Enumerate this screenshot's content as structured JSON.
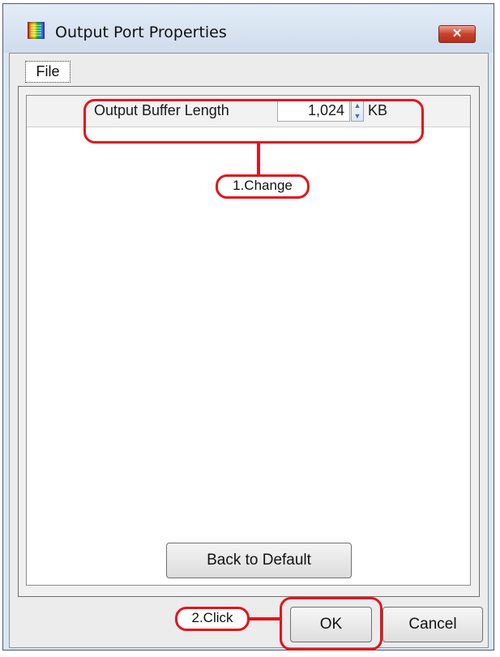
{
  "window": {
    "title": "Output Port Properties",
    "close_symbol": "✕",
    "icon": "app-icon"
  },
  "menu": {
    "items": [
      "File"
    ]
  },
  "buffer": {
    "label": "Output Buffer Length",
    "value": "1,024",
    "unit": "KB"
  },
  "buttons": {
    "back_to_default": "Back to Default",
    "ok": "OK",
    "cancel": "Cancel"
  },
  "annotations": {
    "step1": "1.Change",
    "step2": "2.Click",
    "color": "#e3141c"
  }
}
